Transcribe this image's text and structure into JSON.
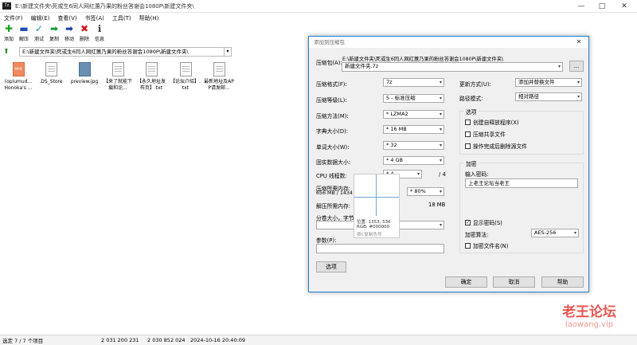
{
  "window": {
    "title": "E:\\新建文件夹\\死或生6同人网红蕙乃果的粉丝答谢会1080P\\新建文件夹\\",
    "app_icon_text": "7z",
    "controls": [
      "—",
      "□",
      "✕"
    ]
  },
  "menu": [
    "文件(F)",
    "编辑(E)",
    "查看(V)",
    "书签(A)",
    "工具(T)",
    "帮助(H)"
  ],
  "toolbar": [
    {
      "label": "添加",
      "icon": "add-icon",
      "glyph": "✚",
      "color": "#1aa31a"
    },
    {
      "label": "解压",
      "icon": "extract-icon",
      "glyph": "▬",
      "color": "#1f4fb5"
    },
    {
      "label": "测试",
      "icon": "test-icon",
      "glyph": "✓",
      "color": "#1f8fa5"
    },
    {
      "label": "复制",
      "icon": "copy-icon",
      "glyph": "➡",
      "color": "#1a9a3a"
    },
    {
      "label": "移动",
      "icon": "move-icon",
      "glyph": "➡",
      "color": "#1f3fa5"
    },
    {
      "label": "删除",
      "icon": "delete-icon",
      "glyph": "✖",
      "color": "#d11a1a"
    },
    {
      "label": "信息",
      "icon": "info-icon",
      "glyph": "ℹ",
      "color": "#3a3a3a"
    }
  ],
  "address": {
    "path": "E:\\新建文件夹\\死或生6同人网红蕙乃果的粉丝答谢会1080P\\新建文件夹\\"
  },
  "files": [
    {
      "name": "(opiumud... Honoka's ...",
      "type": "mp4",
      "icon_text": "MP4"
    },
    {
      "name": ".DS_Store",
      "type": "txt",
      "icon_text": ""
    },
    {
      "name": "preview.jpg",
      "type": "img",
      "icon_text": ""
    },
    {
      "name": "【来了就能下载和论...",
      "type": "txt",
      "icon_text": ""
    },
    {
      "name": "【永久地址发布页】.txt",
      "type": "txt",
      "icon_text": ""
    },
    {
      "name": "【论坛介绍】.txt",
      "type": "txt",
      "icon_text": ""
    },
    {
      "name": "最新地址及APP请发邮...",
      "type": "txt",
      "icon_text": ""
    }
  ],
  "status": {
    "selected": "选定 7 / 7 个项目",
    "size": "2 031 200 231",
    "packed": "2 030 852 024",
    "date": "2024-10-16 20:40:09"
  },
  "dialog": {
    "title": "添加到压缩包",
    "close": "✕",
    "archive_label": "压缩包(A):",
    "archive_path": "E:\\新建文件夹\\死或生6同人网红蕙乃果的粉丝答谢会1080P\\新建文件夹\\",
    "archive_name": "新建文件夹.7z",
    "browse": "...",
    "format_label": "压缩格式(F):",
    "format_value": "7z",
    "level_label": "压缩等级(L):",
    "level_value": "5 - 标准压缩",
    "method_label": "压缩方法(M):",
    "method_value": "* LZMA2",
    "dict_label": "字典大小(D):",
    "dict_value": "* 16 MB",
    "word_label": "单词大小(W):",
    "word_value": "* 32",
    "solid_label": "固实数据大小:",
    "solid_value": "* 4 GB",
    "cpu_label": "CPU 线程数:",
    "cpu_value": "* 4",
    "cpu_total": "/ 4",
    "mem_label": "压缩所需内存:",
    "mem_value": "656 MB / 1434 M",
    "mem_pct": "* 80%",
    "decomp_label": "解压所需内存:",
    "decomp_value": "18 MB",
    "split_label": "分卷大小，字节(V):",
    "params_label": "参数(P):",
    "options_button": "选项",
    "update_label": "更新方式(U):",
    "update_value": "添加并替换文件",
    "pathmode_label": "路径模式:",
    "pathmode_value": "相对路径",
    "options_group": "选项",
    "opt_sfx": "创建自释放程序(X)",
    "opt_shared": "压缩共享文件",
    "opt_delete": "操作完成后删除源文件",
    "encrypt_group": "加密",
    "password_label": "输入密码:",
    "password_value": "上老王论坛当老王",
    "show_password": "显示密码(S)",
    "encrypt_method_label": "加密算法:",
    "encrypt_method_value": "AES-256",
    "encrypt_names": "加密文件名(N)",
    "ok": "确定",
    "cancel": "取消",
    "help": "帮助"
  },
  "color_picker": {
    "pos": "位置: 1353, 536",
    "rgb": "RGB: #000000",
    "hint": "按C复制色号"
  },
  "watermark": {
    "line1": "老王论坛",
    "line2": "laowang.vip"
  },
  "colors": {
    "accent": "#1e7fd6",
    "watermark": "#e53935"
  }
}
